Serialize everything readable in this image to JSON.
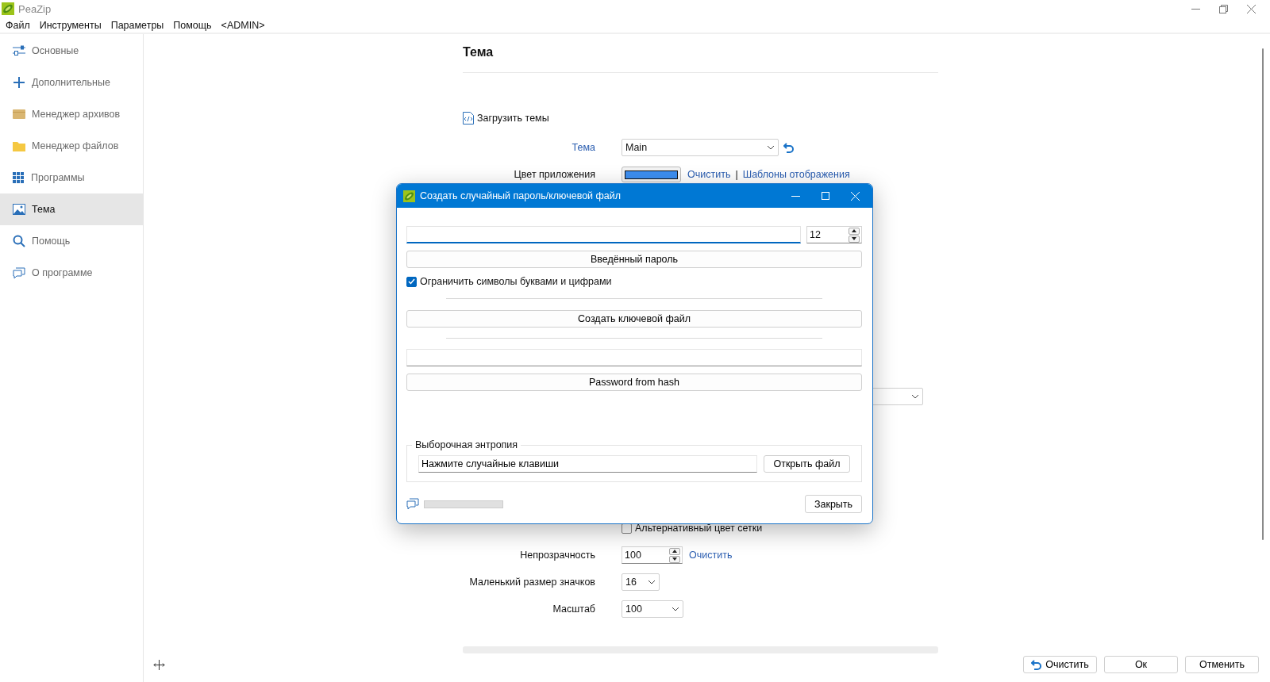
{
  "window": {
    "title": "PeaZip"
  },
  "menu": [
    "Файл",
    "Инструменты",
    "Параметры",
    "Помощь",
    "<ADMIN>"
  ],
  "sidebar": {
    "items": [
      {
        "label": "Основные",
        "selected": false
      },
      {
        "label": "Дополнительные",
        "selected": false
      },
      {
        "label": "Менеджер архивов",
        "selected": false
      },
      {
        "label": "Менеджер файлов",
        "selected": false
      },
      {
        "label": "Программы",
        "selected": false
      },
      {
        "label": "Тема",
        "selected": true
      },
      {
        "label": "Помощь",
        "selected": false
      },
      {
        "label": "О программе",
        "selected": false
      }
    ]
  },
  "page": {
    "title": "Тема",
    "load_themes": "Загрузить темы",
    "rows": [
      {
        "kind": "select",
        "label": "Тема",
        "accent": true,
        "value": "Main",
        "revert": true
      },
      {
        "kind": "color",
        "label": "Цвет приложения",
        "color": "#3d8ef0",
        "separator": "|",
        "links": [
          "Очистить",
          "Шаблоны отображения"
        ]
      },
      {
        "kind": "select-wide"
      },
      {
        "kind": "checkbox",
        "label": "Альтернативный цвет сетки",
        "checked": false
      },
      {
        "kind": "spin",
        "label": "Непрозрачность",
        "value": "100",
        "links": [
          "Очистить"
        ]
      },
      {
        "kind": "select-narrow",
        "label": "Маленький размер значков",
        "value": "16"
      },
      {
        "kind": "select-medium",
        "label": "Масштаб",
        "value": "100"
      }
    ]
  },
  "footer": {
    "buttons": [
      {
        "kind": "revert",
        "label": "Очистить"
      },
      {
        "kind": "plain",
        "label": "Ок"
      },
      {
        "kind": "plain",
        "label": "Отменить"
      }
    ]
  },
  "dialog": {
    "title": "Создать случайный пароль/ключевой файл",
    "length": "12",
    "entered_button": "Введённый пароль",
    "restrict": {
      "label": "Ограничить символы буквами и цифрами",
      "checked": true
    },
    "keyfile_button": "Создать ключевой файл",
    "hash_button": "Password from hash",
    "entropy": {
      "title": "Выборочная энтропия",
      "value": "Нажмите случайные клавиши",
      "open_button": "Открыть файл"
    },
    "progress": {
      "level": 0
    },
    "close_button": "Закрыть"
  }
}
